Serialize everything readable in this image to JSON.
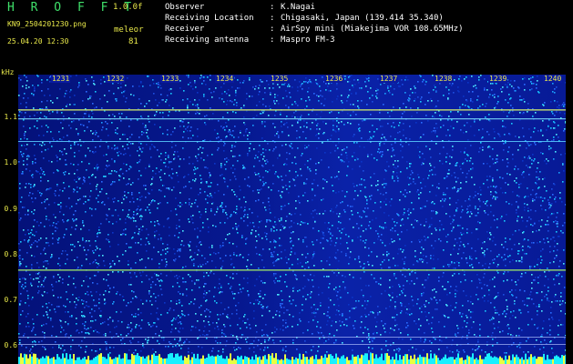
{
  "header": {
    "brand": "H R O F F T",
    "version": "1.0.0f",
    "filename": "KN9_2504201230.png",
    "timestamp": "25.04.20 12:30",
    "meteor_label": "meleor",
    "meteor_count": "81"
  },
  "info": [
    {
      "key": "Observer",
      "value": "K.Nagai"
    },
    {
      "key": "Receiving Location",
      "value": "Chigasaki, Japan (139.414 35.340)"
    },
    {
      "key": "Receiver",
      "value": "AirSpy mini (Miakejima VOR 108.65MHz)"
    },
    {
      "key": "Receiving antenna",
      "value": "Maspro FM-3"
    }
  ],
  "axis": {
    "y_unit": "kHz",
    "y_ticks": [
      "1.1",
      "1.0",
      "0.9",
      "0.8",
      "0.7",
      "0.6"
    ],
    "x_ticks": [
      "1231",
      "1232",
      "1233",
      "1234",
      "1235",
      "1236",
      "1237",
      "1238",
      "1239",
      "1240"
    ]
  },
  "colors": {
    "label_yellow": "#e8e84a",
    "brand_green": "#3fe06a",
    "noise_cyan": "#18c8ff",
    "band_line": "#c8e070"
  }
}
